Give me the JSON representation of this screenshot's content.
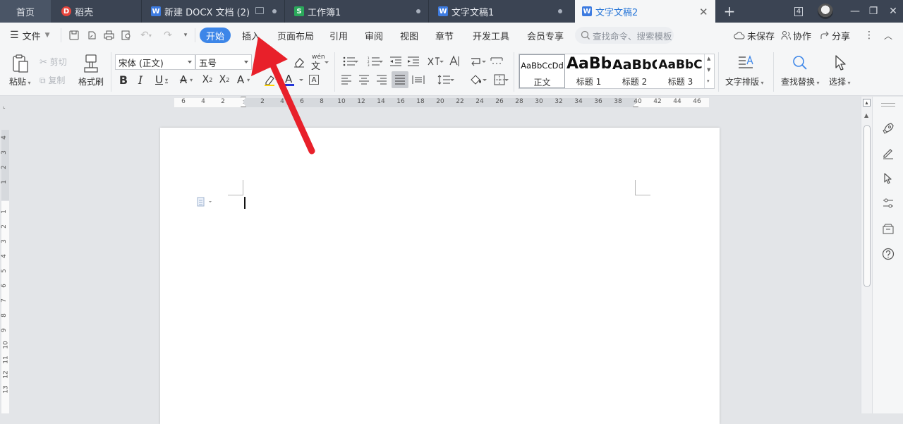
{
  "tabs": {
    "home": "首页",
    "daoke": "稻壳",
    "doc1": "新建 DOCX 文档 (2)",
    "sheet1": "工作簿1",
    "doc2": "文字文稿1",
    "doc3": "文字文稿2"
  },
  "window": {
    "badge": "4"
  },
  "menu": {
    "file": "文件",
    "start": "开始",
    "insert": "插入",
    "layout": "页面布局",
    "references": "引用",
    "review": "审阅",
    "view": "视图",
    "chapter": "章节",
    "devtools": "开发工具",
    "member": "会员专享",
    "search_placeholder": "查找命令、搜索模板",
    "unsaved": "未保存",
    "collab": "协作",
    "share": "分享"
  },
  "ribbon": {
    "paste": "粘贴",
    "cut": "剪切",
    "copy": "复制",
    "format_painter": "格式刷",
    "font_name": "宋体 (正文)",
    "font_size": "五号",
    "styles": [
      {
        "sample": "AaBbCcDd",
        "name": "正文"
      },
      {
        "sample": "AaBb",
        "name": "标题 1"
      },
      {
        "sample": "AaBbC",
        "name": "标题 2"
      },
      {
        "sample": "AaBbC",
        "name": "标题 3"
      }
    ],
    "text_layout": "文字排版",
    "find_replace": "查找替换",
    "select": "选择"
  },
  "ruler": {
    "top_numbers": [
      "6",
      "4",
      "2",
      "",
      "2",
      "4",
      "6",
      "8",
      "10",
      "12",
      "14",
      "16",
      "18",
      "20",
      "22",
      "24",
      "26",
      "28",
      "30",
      "32",
      "34",
      "36",
      "38",
      "40",
      "42",
      "44",
      "46"
    ],
    "left_numbers": [
      "4",
      "3",
      "2",
      "1",
      "",
      "1",
      "2",
      "3",
      "4",
      "5",
      "6",
      "7",
      "8",
      "9",
      "10",
      "11",
      "12",
      "13"
    ]
  },
  "colors": {
    "accent": "#3d86e8",
    "tabbar": "#3b4453",
    "arrow": "#e8202a"
  }
}
